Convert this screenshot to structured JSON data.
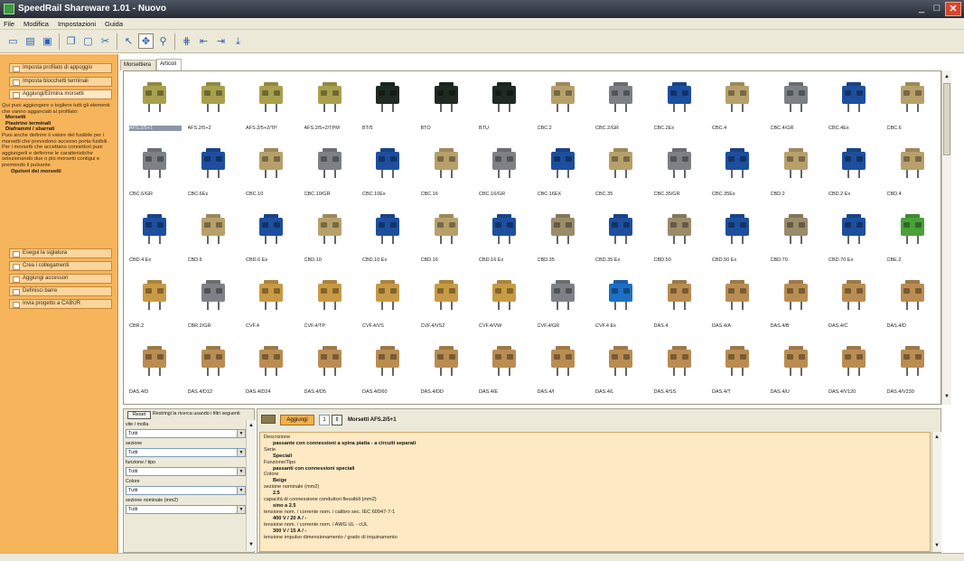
{
  "window": {
    "title": "SpeedRail Shareware 1.01 - Nuovo"
  },
  "menu": [
    "File",
    "Modifica",
    "Impostazioni",
    "Guida"
  ],
  "toolbar": {
    "icons": [
      "new-icon",
      "open-icon",
      "save-icon",
      "copy-icon",
      "paste-icon",
      "cut-icon",
      "pointer-icon",
      "move-icon",
      "zoom-icon",
      "rail-icon",
      "insert-left-icon",
      "insert-right-icon",
      "insert-down-icon"
    ]
  },
  "left": {
    "buttons": [
      "Imposta profilato di appoggio",
      "Imposta blocchetti terminali",
      "Aggiungi/Elimina morsetti",
      "Esegui la siglatura",
      "Crea i collegamenti",
      "Aggiungi accessori",
      "Definisci barre",
      "Invia progetto a CABUR"
    ],
    "help_intro": "Qui puoi aggiungere o togliere tutti gli elementi che vanno agganciati al profilato:",
    "help_items": [
      "Morsetti",
      "Piastrine terminali",
      "Diaframmi / sbarrati"
    ],
    "help_body": "Puoi anche definire il valore del fusibile per i morsetti che prevedono accesso porta-fusibili. Per i morsetti che accettano connettori puoi aggiungerli e definirne le caratteristiche selezionando due o più morsetti contigui e premendo il pulsante",
    "help_end": "Opzioni dei morsetti"
  },
  "tabs": [
    "Morsettiera",
    "Articoli"
  ],
  "grid": {
    "items": [
      "AFS.2/5+1",
      "AFS.2/5+2",
      "AFS.2/5+2/TP",
      "AFS.2/5+2/TPM",
      "BT/5",
      "BTO",
      "BTU",
      "CBC.2",
      "CBC.2/GR",
      "CBC.2Ex",
      "CBC.4",
      "CBC.4/GR",
      "CBC.4Ex",
      "CBC.6",
      "CBC.6/GR",
      "CBC.6Ex",
      "CBC.10",
      "CBC.10/GR",
      "CBC.10Ex",
      "CBC.16",
      "CBC.16/GR",
      "CBC.16EX",
      "CBC.35",
      "CBC.35/GR",
      "CBC.35Ex",
      "CBD.2",
      "CBD.2 Ex",
      "CBD.4",
      "CBD.4 Ex",
      "CBD.6",
      "CBD.6 Ex",
      "CBD.10",
      "CBD.10 Ex",
      "CBD.16",
      "CBD.16 Ex",
      "CBD.35",
      "CBD.35 Ex",
      "CBD.50",
      "CBD.50 Ex",
      "CBD.70",
      "CBD.70 Ex",
      "CBE.2",
      "CBR.2",
      "CBR.2/GR",
      "CVF.4",
      "CVF.4/TP",
      "CVF.4/VS",
      "CVF.4/VS2",
      "CVF.4/VW",
      "CVF.4/GR",
      "CVF.4 Ex",
      "DAS.4",
      "DAS.4/A",
      "DAS.4/B",
      "DAS.4/C",
      "DAS.4/D",
      "DAS.4/D",
      "DAS.4/D12",
      "DAS.4/D24",
      "DAS.4/D5",
      "DAS.4/D60",
      "DAS.4/DD",
      "DAS.4/E",
      "DAS.4/I",
      "DAS.4/L",
      "DAS.4/SS",
      "DAS.4/T",
      "DAS.4/U",
      "DAS.4/V120",
      "DAS.4/V230"
    ],
    "colors": [
      "#a9a04e",
      "#a9a04e",
      "#a9a04e",
      "#a9a04e",
      "#1f2a22",
      "#1f2a22",
      "#1f2a22",
      "#b7a06a",
      "#7d8186",
      "#1d4f9e",
      "#b7a06a",
      "#7d8186",
      "#1d4f9e",
      "#b7a06a",
      "#7d8186",
      "#1d4f9e",
      "#b7a06a",
      "#7d8186",
      "#1d4f9e",
      "#b7a06a",
      "#7d8186",
      "#1d4f9e",
      "#b7a06a",
      "#7d8186",
      "#1d4f9e",
      "#b7a06a",
      "#1d4f9e",
      "#b7a06a",
      "#1d4f9e",
      "#b7a06a",
      "#1d4f9e",
      "#b7a06a",
      "#1d4f9e",
      "#b7a06a",
      "#1d4f9e",
      "#9a8c6a",
      "#1d4f9e",
      "#9a8c6a",
      "#1d4f9e",
      "#9a8c6a",
      "#1d4f9e",
      "#4aa13a",
      "#c89a45",
      "#7d8186",
      "#c89a45",
      "#c89a45",
      "#c89a45",
      "#c89a45",
      "#c89a45",
      "#7d8186",
      "#1d6fc4",
      "#b98d52",
      "#b98d52",
      "#b98d52",
      "#b98d52",
      "#b98d52",
      "#b98d52",
      "#b98d52",
      "#b98d52",
      "#b98d52",
      "#b98d52",
      "#b98d52",
      "#b98d52",
      "#b98d52",
      "#b98d52",
      "#b98d52",
      "#b98d52",
      "#b98d52",
      "#b98d52",
      "#b98d52"
    ]
  },
  "filters": {
    "reset_label": "Reset",
    "restrict_label": "Restringi la ricerca usando i filtri seguenti",
    "fields": [
      {
        "label": "vite / molla",
        "value": "Tutti"
      },
      {
        "label": "sezione",
        "value": "Tutti"
      },
      {
        "label": "funzione / tipo",
        "value": "Tutti"
      },
      {
        "label": "Colore",
        "value": "Tutti"
      },
      {
        "label": "sezione nominale (mm2)",
        "value": "Tutti"
      }
    ]
  },
  "detail": {
    "add_label": "Aggiungi",
    "qty": "1",
    "selected": "Morsetti AFS.2/5+1",
    "rows": [
      {
        "k": "Descrizione",
        "v": "passante con connessioni a spina piatta - a circuiti separati"
      },
      {
        "k": "Serie",
        "v": "Speciali"
      },
      {
        "k": "Funzione/Tipo",
        "v": "passanti con connessioni speciali"
      },
      {
        "k": "Colore",
        "v": "Beige"
      },
      {
        "k": "sezione nominale (mm2)",
        "v": "2.5"
      },
      {
        "k": "capacità di connessione conduttori flessibili (mm2)",
        "v": "sino a 2.5"
      },
      {
        "k": "tensione nom. / corrente nom. / calibro sec. IEC 60947-7-1",
        "v": "400 V / 20 A / -"
      },
      {
        "k": "tensione nom. / corrente nom. / AWG UL - cUL",
        "v": "300 V / 15 A / -"
      },
      {
        "k": "tensione impulso dimensionamento / grado di inquinamento",
        "v": ""
      }
    ]
  }
}
